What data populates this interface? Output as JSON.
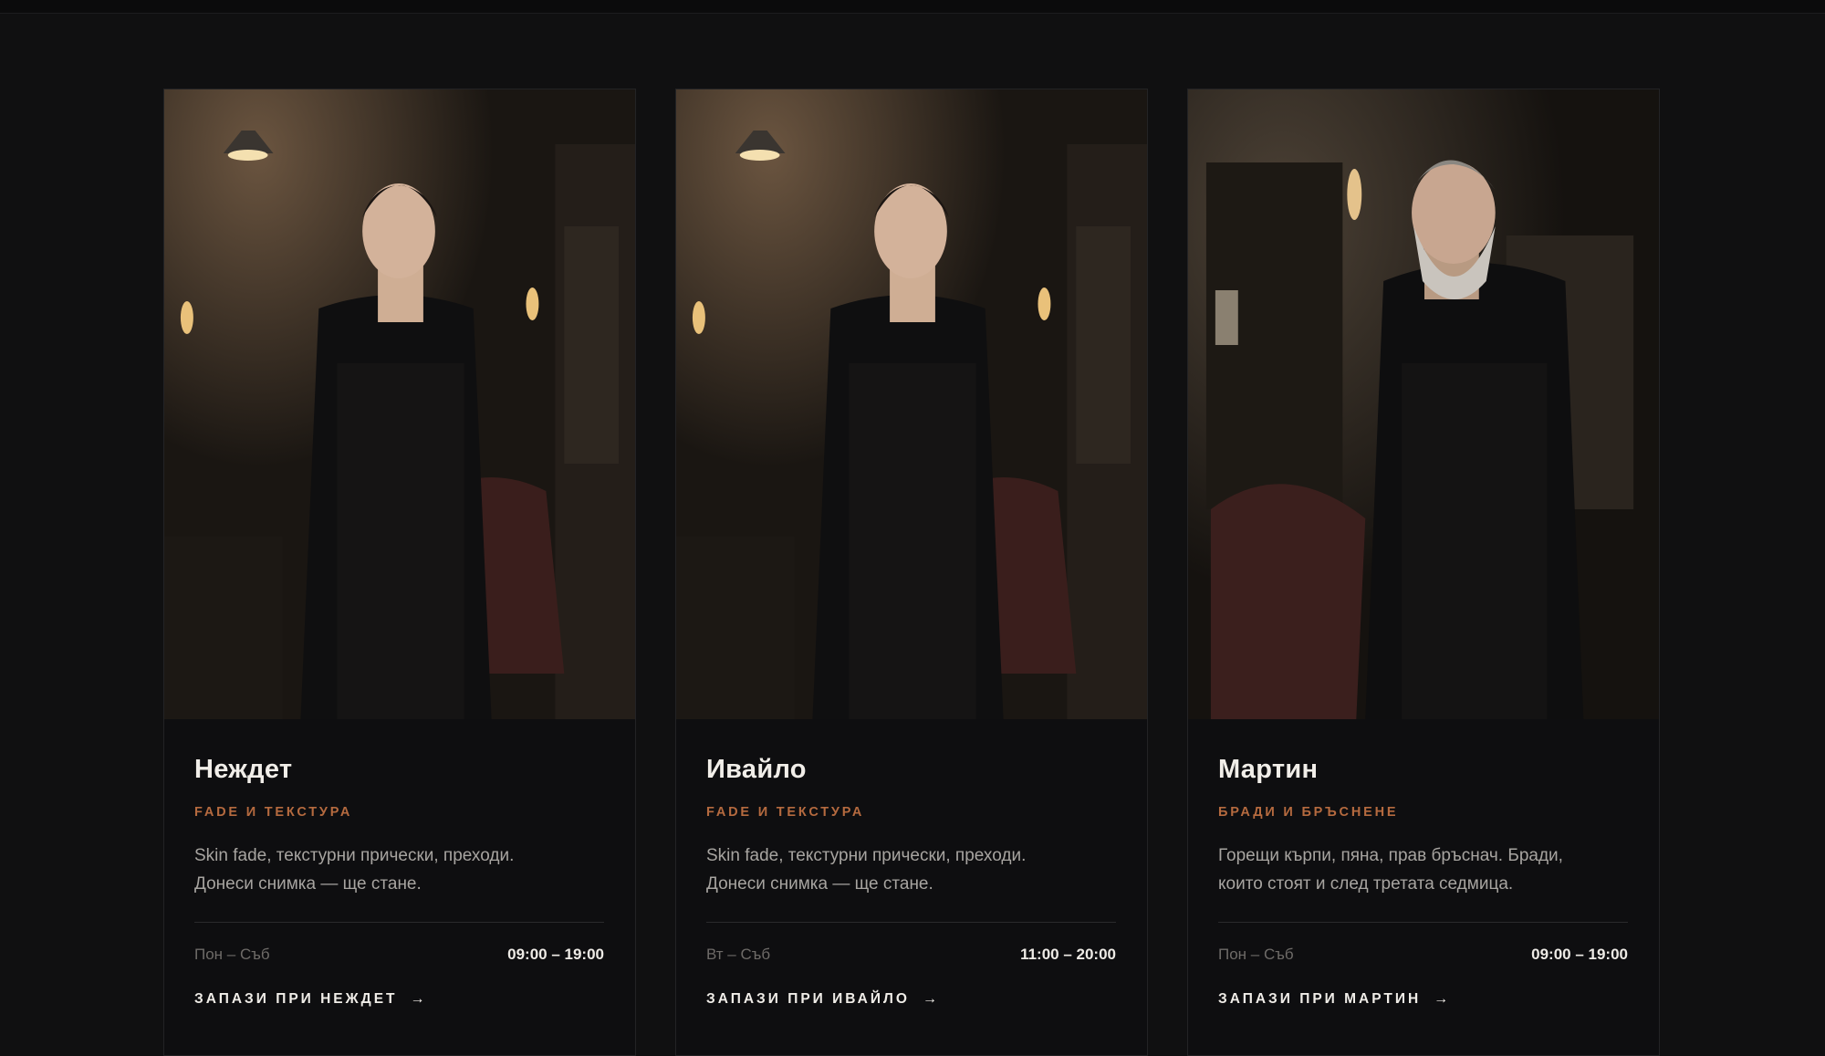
{
  "barbers": [
    {
      "name": "Неждет",
      "specialty": "FADE И ТЕКСТУРА",
      "description_line1": "Skin fade, текстурни прически, преходи.",
      "description_line2": "Донеси снимка — ще стане.",
      "days": "Пон – Съб",
      "hours": "09:00 – 19:00",
      "cta": "ЗАПАЗИ ПРИ НЕЖДЕТ",
      "cta_icon": "arrow-right-icon",
      "arrow_glyph": "→"
    },
    {
      "name": "Ивайло",
      "specialty": "FADE И ТЕКСТУРА",
      "description_line1": "Skin fade, текстурни прически, преходи.",
      "description_line2": "Донеси снимка — ще стане.",
      "days": "Вт – Съб",
      "hours": "11:00 – 20:00",
      "cta": "ЗАПАЗИ ПРИ ИВАЙЛО",
      "cta_icon": "arrow-right-icon",
      "arrow_glyph": "→"
    },
    {
      "name": "Мартин",
      "specialty": "БРАДИ И БРЪСНЕНЕ",
      "description_line1": "Горещи кърпи, пяна, прав бръснач. Бради,",
      "description_line2": "които стоят и след третата седмица.",
      "days": "Пон – Съб",
      "hours": "09:00 – 19:00",
      "cta": "ЗАПАЗИ ПРИ МАРТИН",
      "cta_icon": "arrow-right-icon",
      "arrow_glyph": "→"
    }
  ],
  "colors": {
    "background": "#101011",
    "card": "#0e0e10",
    "accent": "#b56a3f",
    "text_primary": "#f1eee9",
    "text_muted": "#a7a4a0"
  }
}
